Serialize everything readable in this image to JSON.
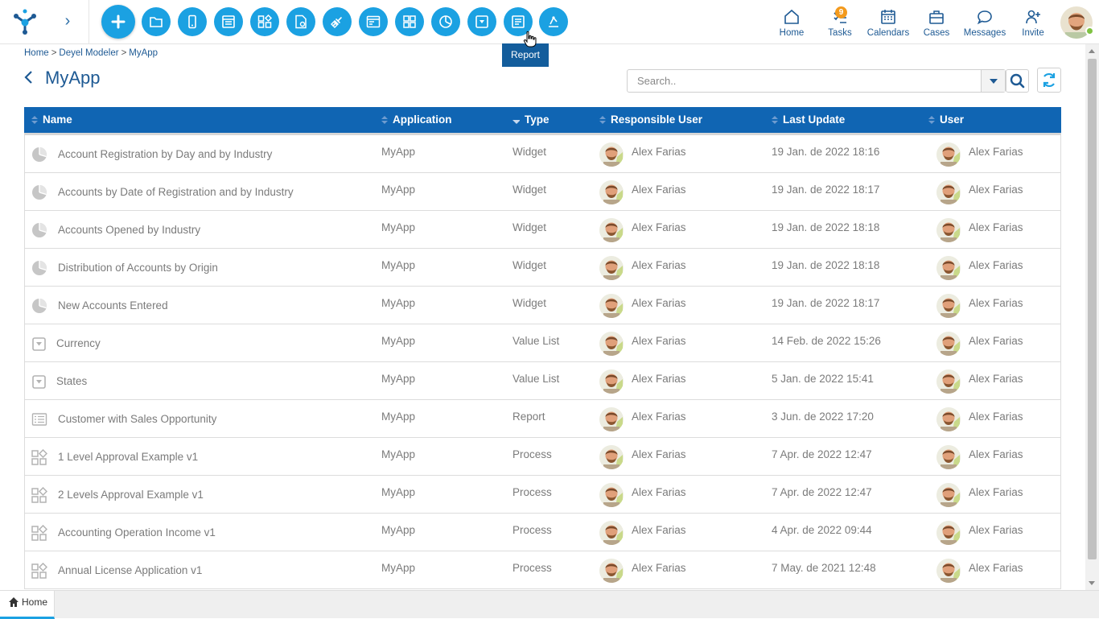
{
  "toolbar": {
    "tools": [
      {
        "name": "add-icon",
        "label": "New"
      },
      {
        "name": "folder-icon"
      },
      {
        "name": "mobile-icon"
      },
      {
        "name": "form-icon"
      },
      {
        "name": "process-icon"
      },
      {
        "name": "rule-icon"
      },
      {
        "name": "connector-icon"
      },
      {
        "name": "page-icon"
      },
      {
        "name": "dashboard-icon"
      },
      {
        "name": "widget-icon"
      },
      {
        "name": "value-list-icon"
      },
      {
        "name": "report-icon"
      },
      {
        "name": "integration-icon"
      }
    ],
    "tooltip": "Report",
    "accent": "#1ba1e2"
  },
  "topnav": {
    "home": "Home",
    "tasks": "Tasks",
    "tasks_badge": "9",
    "calendars": "Calendars",
    "cases": "Cases",
    "messages": "Messages",
    "invite": "Invite"
  },
  "breadcrumb": {
    "items": [
      "Home",
      "Deyel Modeler",
      "MyApp"
    ],
    "separator": ">"
  },
  "page": {
    "title": "MyApp"
  },
  "search": {
    "placeholder": "Search..",
    "value": ""
  },
  "table": {
    "header_color": "#1065b3",
    "columns": [
      "Name",
      "Application",
      "Type",
      "Responsible User",
      "Last Update",
      "User"
    ],
    "rows": [
      {
        "icon": "widget-icon",
        "name": "Account Registration by Day and by Industry",
        "application": "MyApp",
        "type": "Widget",
        "responsible": "Alex Farias",
        "updated": "19 Jan. de 2022 18:16",
        "user": "Alex Farias"
      },
      {
        "icon": "widget-icon",
        "name": "Accounts by Date of Registration and by Industry",
        "application": "MyApp",
        "type": "Widget",
        "responsible": "Alex Farias",
        "updated": "19 Jan. de 2022 18:17",
        "user": "Alex Farias"
      },
      {
        "icon": "widget-icon",
        "name": "Accounts Opened by Industry",
        "application": "MyApp",
        "type": "Widget",
        "responsible": "Alex Farias",
        "updated": "19 Jan. de 2022 18:18",
        "user": "Alex Farias"
      },
      {
        "icon": "widget-icon",
        "name": "Distribution of Accounts by Origin",
        "application": "MyApp",
        "type": "Widget",
        "responsible": "Alex Farias",
        "updated": "19 Jan. de 2022 18:18",
        "user": "Alex Farias"
      },
      {
        "icon": "widget-icon",
        "name": "New Accounts Entered",
        "application": "MyApp",
        "type": "Widget",
        "responsible": "Alex Farias",
        "updated": "19 Jan. de 2022 18:17",
        "user": "Alex Farias"
      },
      {
        "icon": "value-list-icon",
        "name": "Currency",
        "application": "MyApp",
        "type": "Value List",
        "responsible": "Alex Farias",
        "updated": "14 Feb. de 2022 15:26",
        "user": "Alex Farias"
      },
      {
        "icon": "value-list-icon",
        "name": "States",
        "application": "MyApp",
        "type": "Value List",
        "responsible": "Alex Farias",
        "updated": "5 Jan. de 2022 15:41",
        "user": "Alex Farias"
      },
      {
        "icon": "report-icon",
        "name": "Customer with Sales Opportunity",
        "application": "MyApp",
        "type": "Report",
        "responsible": "Alex Farias",
        "updated": "3 Jun. de 2022 17:20",
        "user": "Alex Farias"
      },
      {
        "icon": "process-icon",
        "name": "1 Level Approval Example v1",
        "application": "MyApp",
        "type": "Process",
        "responsible": "Alex Farias",
        "updated": "7 Apr. de 2022 12:47",
        "user": "Alex Farias"
      },
      {
        "icon": "process-icon",
        "name": "2 Levels Approval Example v1",
        "application": "MyApp",
        "type": "Process",
        "responsible": "Alex Farias",
        "updated": "7 Apr. de 2022 12:47",
        "user": "Alex Farias"
      },
      {
        "icon": "process-icon",
        "name": "Accounting Operation Income v1",
        "application": "MyApp",
        "type": "Process",
        "responsible": "Alex Farias",
        "updated": "4 Apr. de 2022 09:44",
        "user": "Alex Farias"
      },
      {
        "icon": "process-icon",
        "name": "Annual License Application v1",
        "application": "MyApp",
        "type": "Process",
        "responsible": "Alex Farias",
        "updated": "7 May. de 2021 12:48",
        "user": "Alex Farias"
      }
    ]
  },
  "footer": {
    "home_tab": "Home"
  }
}
